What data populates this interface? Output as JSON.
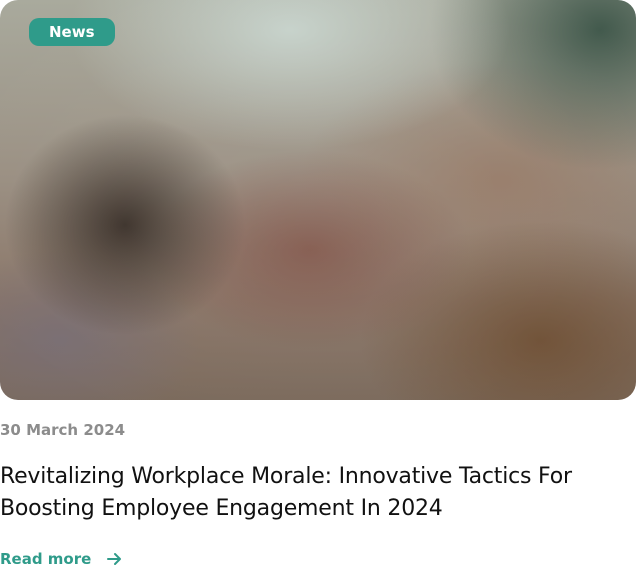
{
  "card": {
    "tag": "News",
    "date": "30 March 2024",
    "title": "Revitalizing Workplace Morale: Innovative Tactics For Boosting Employee Engagement In 2024",
    "read_more_label": "Read more",
    "read_more_icon": "arrow-right-icon"
  },
  "colors": {
    "accent": "#2f9b8a",
    "date_text": "#8c8c8c",
    "title_text": "#111111"
  }
}
